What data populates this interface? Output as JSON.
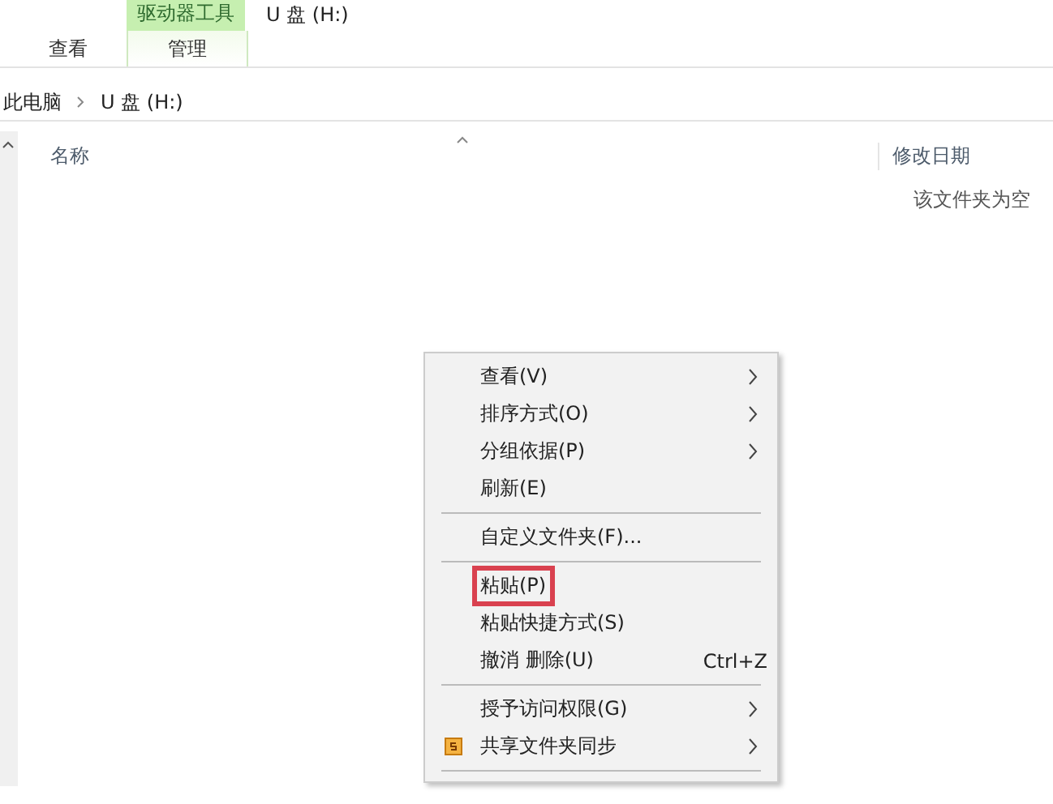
{
  "ribbon": {
    "tabs": [
      {
        "label": "查看",
        "selected": false
      },
      {
        "label": "管理",
        "selected": true
      }
    ],
    "context_tab": "驱动器工具",
    "title": "U 盘 (H:)"
  },
  "address_bar": {
    "path": [
      "此电脑",
      "U 盘 (H:)"
    ]
  },
  "columns": [
    "名称",
    "修改日期"
  ],
  "empty_message": "该文件夹为空",
  "context_menu": [
    {
      "kind": "item",
      "label": "查看(V)",
      "submenu": true
    },
    {
      "kind": "item",
      "label": "排序方式(O)",
      "submenu": true
    },
    {
      "kind": "item",
      "label": "分组依据(P)",
      "submenu": true
    },
    {
      "kind": "item",
      "label": "刷新(E)",
      "submenu": false
    },
    {
      "kind": "separator"
    },
    {
      "kind": "item",
      "label": "自定义文件夹(F)...",
      "submenu": false
    },
    {
      "kind": "separator"
    },
    {
      "kind": "item",
      "label": "粘贴(P)",
      "submenu": false,
      "highlighted": true
    },
    {
      "kind": "item",
      "label": "粘贴快捷方式(S)",
      "submenu": false
    },
    {
      "kind": "item",
      "label": "撤消 删除(U)",
      "shortcut": "Ctrl+Z",
      "submenu": false
    },
    {
      "kind": "separator"
    },
    {
      "kind": "item",
      "label": "授予访问权限(G)",
      "submenu": true
    },
    {
      "kind": "sync_item",
      "label": "共享文件夹同步",
      "submenu": true
    },
    {
      "kind": "separator"
    }
  ]
}
